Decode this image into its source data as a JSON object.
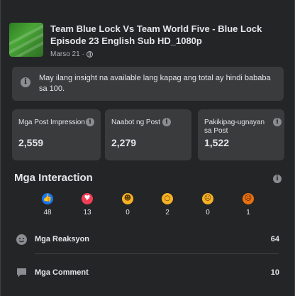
{
  "post": {
    "title": "Team Blue Lock Vs Team World Five - Blue Lock Episode 23 English Sub HD_1080p",
    "date": "Marso 21 ·",
    "privacy_icon": "globe-icon"
  },
  "info_banner": {
    "icon": "info-icon",
    "text": "May ilang insight na available lang kapag ang total ay hindi bababa sa 100."
  },
  "metrics": [
    {
      "label": "Mga Post Impression",
      "value": "2,559"
    },
    {
      "label": "Naabot ng Post",
      "value": "2,279"
    },
    {
      "label": "Pakikipag-ugnayan sa Post",
      "value": "1,522"
    }
  ],
  "interactions": {
    "title": "Mga Interaction",
    "reactions": [
      {
        "icon": "like-icon",
        "count": "48",
        "color": "#1877f2"
      },
      {
        "icon": "love-icon",
        "count": "13",
        "color": "#f33e58"
      },
      {
        "icon": "haha-icon",
        "count": "0",
        "color": "#f7b125"
      },
      {
        "icon": "wow-icon",
        "count": "2",
        "color": "#f7b125"
      },
      {
        "icon": "sad-icon",
        "count": "0",
        "color": "#f7b125"
      },
      {
        "icon": "angry-icon",
        "count": "1",
        "color": "#e9710f"
      }
    ],
    "rows": [
      {
        "icon": "reactions-icon",
        "label": "Mga Reaksyon",
        "value": "64"
      },
      {
        "icon": "comment-icon",
        "label": "Mga Comment",
        "value": "10"
      }
    ]
  }
}
